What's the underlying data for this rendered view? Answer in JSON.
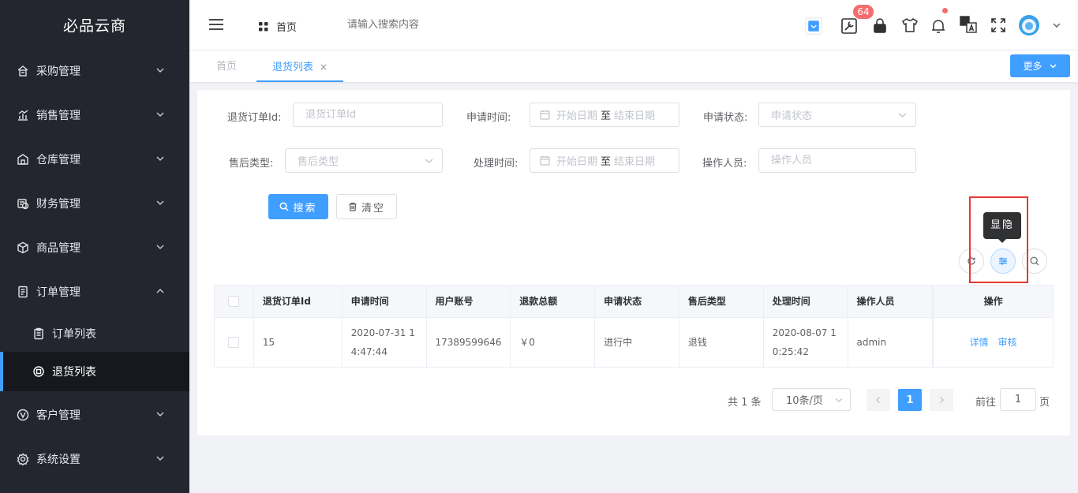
{
  "app": {
    "brand": "必品云商"
  },
  "sidebar": {
    "items": [
      {
        "label": "采购管理",
        "icon": "purchase-icon"
      },
      {
        "label": "销售管理",
        "icon": "sales-chart-icon"
      },
      {
        "label": "仓库管理",
        "icon": "warehouse-icon"
      },
      {
        "label": "财务管理",
        "icon": "finance-icon"
      },
      {
        "label": "商品管理",
        "icon": "goods-box-icon"
      },
      {
        "label": "订单管理",
        "icon": "order-doc-icon",
        "expanded": true
      },
      {
        "label": "客户管理",
        "icon": "customer-icon"
      },
      {
        "label": "系统设置",
        "icon": "gear-icon"
      }
    ],
    "subitems": [
      {
        "label": "订单列表",
        "icon": "clipboard-icon"
      },
      {
        "label": "退货列表",
        "icon": "return-icon",
        "active": true
      }
    ]
  },
  "header": {
    "home_label": "首页",
    "search_placeholder": "请输入搜索内容",
    "badge_count": "64"
  },
  "tabs": [
    {
      "label": "首页"
    },
    {
      "label": "退货列表",
      "close": "×"
    }
  ],
  "more_label": "更多",
  "filters": {
    "return_id_label": "退货订单Id:",
    "return_id_placeholder": "退货订单Id",
    "apply_time_label": "申请时间:",
    "start_placeholder": "开始日期",
    "range_sep": "至",
    "end_placeholder": "结束日期",
    "apply_status_label": "申请状态:",
    "apply_status_placeholder": "申请状态",
    "aftersale_type_label": "售后类型:",
    "aftersale_type_placeholder": "售后类型",
    "handle_time_label": "处理时间:",
    "operator_label": "操作人员:",
    "operator_placeholder": "操作人员"
  },
  "buttons": {
    "search": "搜索",
    "clear": "清空"
  },
  "tooltip": "显隐",
  "table": {
    "headers": [
      "退货订单Id",
      "申请时间",
      "用户账号",
      "退款总额",
      "申请状态",
      "售后类型",
      "处理时间",
      "操作人员",
      "操作"
    ],
    "rows": [
      {
        "id": "15",
        "apply_time": "2020-07-31 14:47:44",
        "account": "17389599646",
        "amount": "￥0",
        "status": "进行中",
        "type": "退钱",
        "handle_time": "2020-08-07 10:25:42",
        "operator": "admin",
        "actions": [
          "详情",
          "审核"
        ]
      }
    ]
  },
  "pagination": {
    "total": "共 1 条",
    "page_size": "10条/页",
    "current": "1",
    "goto_label": "前往",
    "goto_value": "1",
    "page_suffix": "页"
  },
  "colors": {
    "primary": "#409eff",
    "sidebar_bg": "#23262e",
    "badge": "#f56c6c",
    "highlight_box": "#e53935"
  }
}
